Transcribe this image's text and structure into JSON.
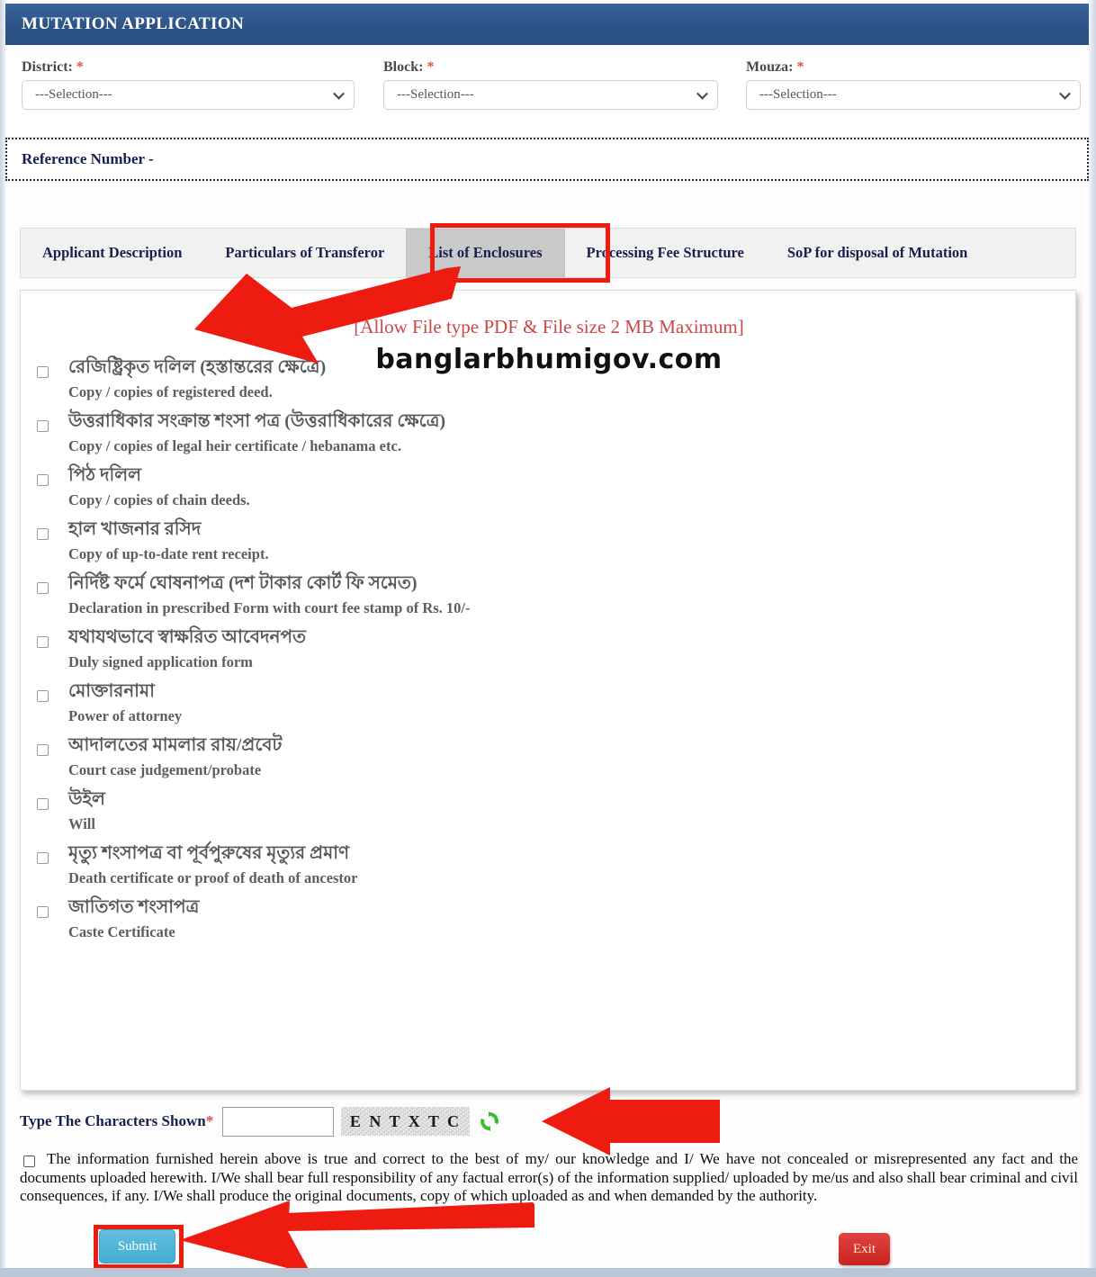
{
  "window": {
    "title": "MUTATION APPLICATION"
  },
  "colors": {
    "header_blue": "#2d5488",
    "annotation_red": "#ee1b11",
    "notice_red": "#c94747",
    "tab_text": "#17204d",
    "submit_blue": "#41add2",
    "exit_red": "#c9231f"
  },
  "selectors": {
    "district": {
      "label": "District:",
      "required": "*",
      "value": "---Selection---"
    },
    "block": {
      "label": "Block:",
      "required": "*",
      "value": "---Selection---"
    },
    "mouza": {
      "label": "Mouza:",
      "required": "*",
      "value": "---Selection---"
    }
  },
  "reference": {
    "label": "Reference Number -"
  },
  "tabs": [
    {
      "label": "Applicant Description",
      "active": false
    },
    {
      "label": "Particulars of Transferor",
      "active": false
    },
    {
      "label": "List of Enclosures",
      "active": true
    },
    {
      "label": "Processing Fee Structure",
      "active": false
    },
    {
      "label": "SoP for disposal of Mutation",
      "active": false
    }
  ],
  "panel": {
    "notice": "[Allow File type PDF & File size 2 MB Maximum]",
    "watermark": "banglarbhumigov.com"
  },
  "enclosures": [
    {
      "bn": "রেজিষ্ট্রিকৃত দলিল (হস্তান্তরের ক্ষেত্রে)",
      "en": "Copy / copies of registered deed."
    },
    {
      "bn": "উত্তরাধিকার সংক্রান্ত শংসা পত্র (উত্তরাধিকারের ক্ষেত্রে)",
      "en": "Copy / copies of legal heir certificate / hebanama etc."
    },
    {
      "bn": "পিঠ দলিল",
      "en": "Copy / copies of chain deeds."
    },
    {
      "bn": "হাল খাজনার রসিদ",
      "en": "Copy of up-to-date rent receipt."
    },
    {
      "bn": "নির্দিষ্ট ফর্মে ঘোষনাপত্র (দশ টাকার কোর্ট ফি সমেত)",
      "en": "Declaration in prescribed Form with court fee stamp of Rs. 10/-"
    },
    {
      "bn": "যথাযথভাবে স্বাক্ষরিত আবেদনপত",
      "en": "Duly signed application form"
    },
    {
      "bn": "মোক্তারনামা",
      "en": "Power of attorney"
    },
    {
      "bn": "আদালতের মামলার রায়/প্রবেট",
      "en": "Court case judgement/probate"
    },
    {
      "bn": "উইল",
      "en": "Will"
    },
    {
      "bn": "মৃত্যু শংসাপত্র বা পূর্বপুরুষের মৃত্যুর প্রমাণ",
      "en": "Death certificate or proof of death of ancestor"
    },
    {
      "bn": "জাতিগত শংসাপত্র",
      "en": "Caste Certificate"
    }
  ],
  "captcha": {
    "label": "Type The Characters Shown",
    "required": "*",
    "input_value": "",
    "input_placeholder": "",
    "code": "E N T X T C",
    "refresh_icon": "refresh-icon"
  },
  "declaration": {
    "checked": false,
    "text": "The information furnished herein above is true and correct to the best of my/ our knowledge and I/ We have not concealed or misrepresented any fact and the documents uploaded herewith. I/We shall bear full responsibility of any factual error(s) of the information supplied/ uploaded by me/us and also shall bear criminal and civil consequences, if any. I/We shall produce the original documents, copy of which uploaded as and when demanded by the authority."
  },
  "buttons": {
    "submit": "Submit",
    "exit": "Exit"
  }
}
